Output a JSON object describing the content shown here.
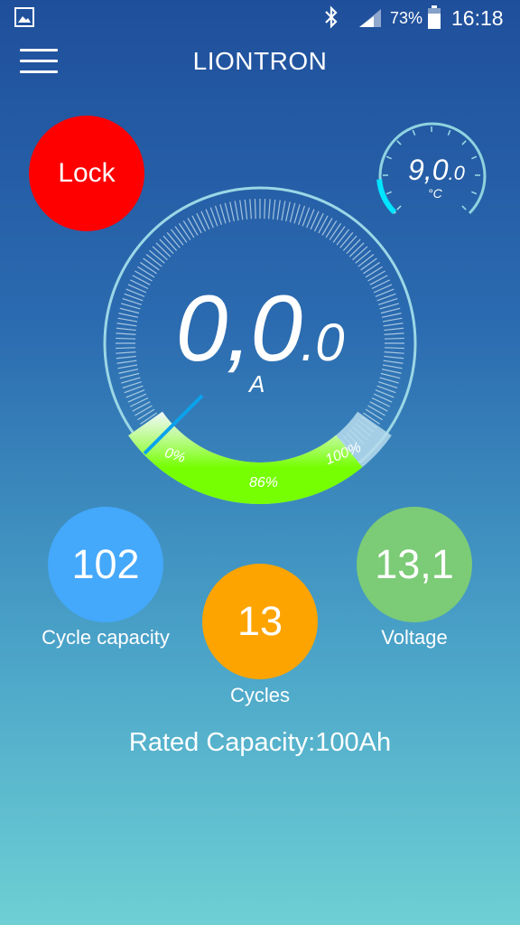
{
  "status_bar": {
    "battery_percent": "73%",
    "time": "16:18",
    "icons": [
      "gallery-icon",
      "bluetooth-icon",
      "signal-icon",
      "battery-icon"
    ]
  },
  "header": {
    "title": "LIONTRON",
    "menu_icon": "hamburger-menu-icon"
  },
  "lock_button": {
    "label": "Lock",
    "color": "#fe0000"
  },
  "temperature": {
    "value_main": "9,0",
    "value_decimal": ".0",
    "unit": "°C",
    "level": 0.15,
    "accent_color": "#00e5ff"
  },
  "current": {
    "value_main": "0,0",
    "value_decimal": ".0",
    "unit": "A"
  },
  "state_of_charge": {
    "min_label": "0%",
    "current_label": "86%",
    "max_label": "100%",
    "level": 0.86,
    "fill_color": "#76ff03"
  },
  "stats": {
    "cycle_capacity": {
      "value": "102",
      "label": "Cycle capacity",
      "color": "#44a8fb"
    },
    "cycles": {
      "value": "13",
      "label": "Cycles",
      "color": "#fda400"
    },
    "voltage": {
      "value": "13,1",
      "label": "Voltage",
      "color": "#7ccb77"
    }
  },
  "rated_capacity": "Rated Capacity:100Ah"
}
